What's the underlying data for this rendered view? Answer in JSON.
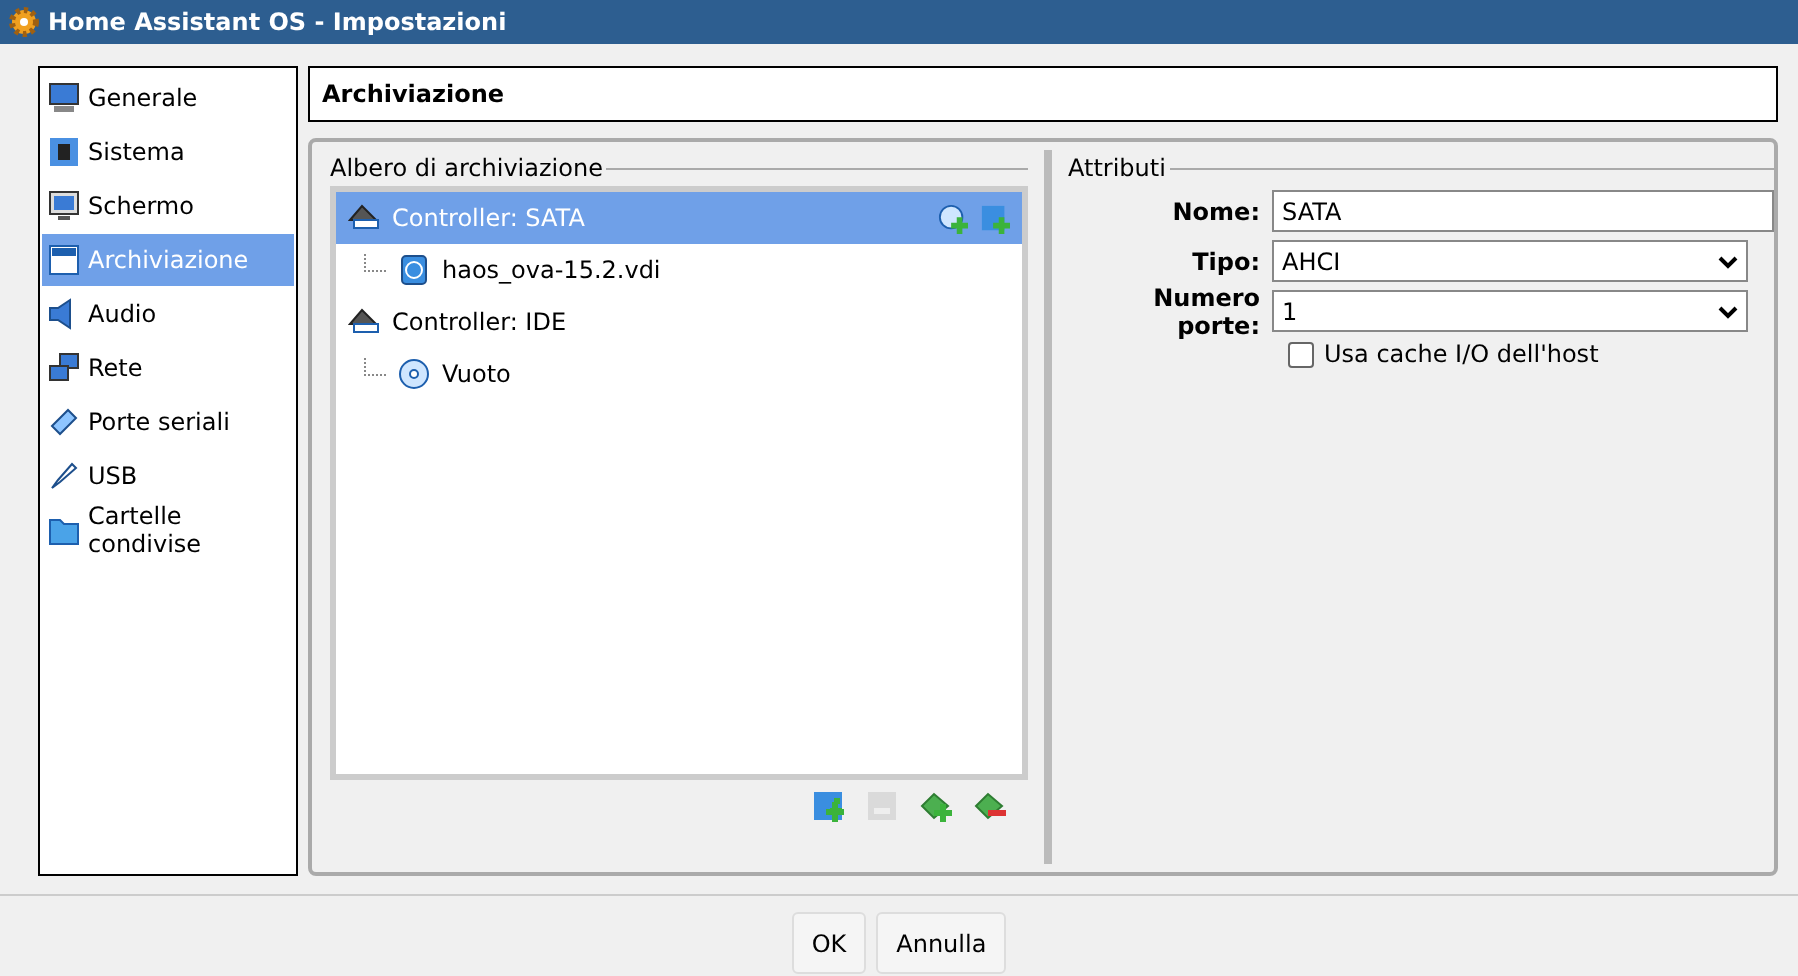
{
  "window": {
    "title": "Home Assistant OS - Impostazioni"
  },
  "sidebar": {
    "items": [
      {
        "label": "Generale",
        "kind": "monitor",
        "selected": false
      },
      {
        "label": "Sistema",
        "kind": "chip",
        "selected": false
      },
      {
        "label": "Schermo",
        "kind": "display",
        "selected": false
      },
      {
        "label": "Archiviazione",
        "kind": "storage",
        "selected": true
      },
      {
        "label": "Audio",
        "kind": "speaker",
        "selected": false
      },
      {
        "label": "Rete",
        "kind": "network",
        "selected": false
      },
      {
        "label": "Porte seriali",
        "kind": "serial",
        "selected": false
      },
      {
        "label": "USB",
        "kind": "usb",
        "selected": false
      },
      {
        "label": "Cartelle condivise",
        "kind": "folder",
        "selected": false
      }
    ]
  },
  "page_title": "Archiviazione",
  "storage_tree": {
    "title": "Albero di archiviazione",
    "items": [
      {
        "label": "Controller: SATA",
        "kind": "controller",
        "selected": true,
        "children": [
          {
            "label": "haos_ova-15.2.vdi",
            "kind": "disk",
            "selected": false
          }
        ]
      },
      {
        "label": "Controller: IDE",
        "kind": "controller",
        "selected": false,
        "children": [
          {
            "label": "Vuoto",
            "kind": "optical",
            "selected": false
          }
        ]
      }
    ]
  },
  "tree_toolbar": [
    {
      "kind": "add-disk",
      "disabled": false
    },
    {
      "kind": "remove-disk",
      "disabled": true
    },
    {
      "kind": "add-controller",
      "disabled": false
    },
    {
      "kind": "remove-controller",
      "disabled": false
    }
  ],
  "attributes": {
    "title": "Attributi",
    "name": {
      "label": "Nome:",
      "value": "SATA"
    },
    "type": {
      "label": "Tipo:",
      "value": "AHCI"
    },
    "ports": {
      "label": "Numero porte:",
      "value": "1"
    },
    "host_cache": {
      "label": "Usa cache I/O dell'host",
      "checked": false
    }
  },
  "buttons": [
    "OK",
    "Annulla"
  ]
}
